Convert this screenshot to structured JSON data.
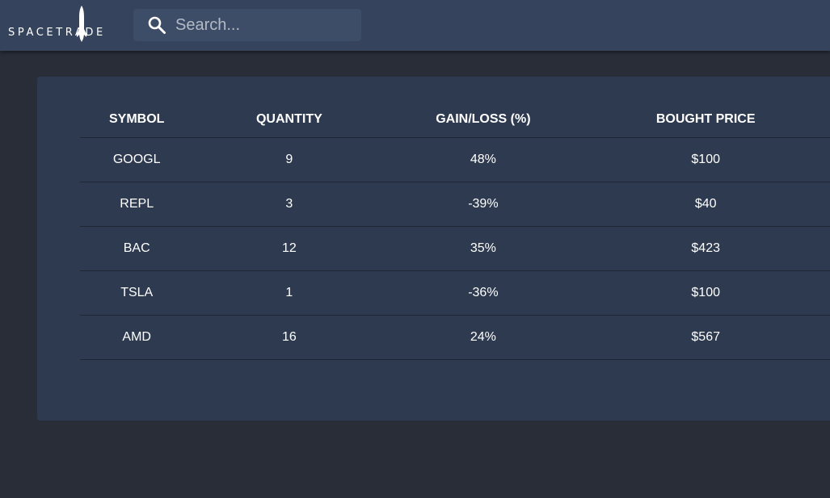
{
  "brand": {
    "name": "SPACETRADE",
    "logo_icon": "rocket-icon"
  },
  "search": {
    "placeholder": "Search...",
    "value": "",
    "icon": "search-icon"
  },
  "colors": {
    "topbar": "#35445c",
    "background": "#282d38",
    "panel": "#2e3a4f",
    "search_bg": "#3e4d67",
    "text": "#ffffff"
  },
  "table": {
    "headers": [
      "SYMBOL",
      "QUANTITY",
      "GAIN/LOSS (%)",
      "BOUGHT PRICE"
    ],
    "rows": [
      [
        "GOOGL",
        "9",
        "48%",
        "$100"
      ],
      [
        "REPL",
        "3",
        "-39%",
        "$40"
      ],
      [
        "BAC",
        "12",
        "35%",
        "$423"
      ],
      [
        "TSLA",
        "1",
        "-36%",
        "$100"
      ],
      [
        "AMD",
        "16",
        "24%",
        "$567"
      ]
    ]
  }
}
